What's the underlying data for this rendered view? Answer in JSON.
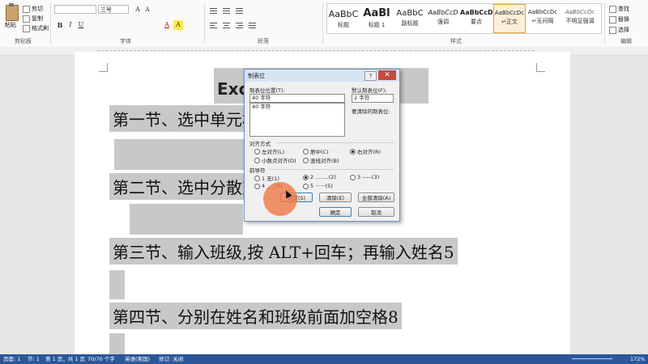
{
  "ribbon": {
    "paste_label": "粘贴",
    "cut_label": "剪切",
    "copy_label": "复制",
    "format_painter_label": "格式刷",
    "clipboard_label": "剪贴板",
    "font_size_value": "三号",
    "font_label": "字体",
    "paragraph_label": "段落",
    "styles_label": "样式",
    "editing_label": "编辑",
    "bold": "B",
    "italic": "I",
    "underline": "U",
    "font_a": "A",
    "find_label": "查找",
    "replace_label": "替换",
    "select_label": "选择",
    "styles": [
      {
        "sample": "AaBbC",
        "name": "标题"
      },
      {
        "sample": "AaBl",
        "name": "标题 1"
      },
      {
        "sample": "AaBbC",
        "name": "副标题"
      },
      {
        "sample": "AaBbCcD",
        "name": "强调"
      },
      {
        "sample": "AaBbCcD",
        "name": "要点"
      },
      {
        "sample": "AaBbCcDc",
        "name": "↵正文"
      },
      {
        "sample": "AaBbCcDc",
        "name": "↵无间隔"
      },
      {
        "sample": "AaBbCcDc",
        "name": "不明显强调"
      }
    ]
  },
  "document": {
    "title": "Exc方法",
    "lines": [
      "第一节、选中单元格",
      "第二节、选中分散对",
      "第三节、输入班级,按 ALT+回车；再输入姓名5",
      "第四节、分别在姓名和班级前面加空格8"
    ]
  },
  "dialog": {
    "title": "制表位",
    "help": "?",
    "close": "✕",
    "tab_position_label": "制表位位置(T):",
    "tab_position_value": "40 字符",
    "tab_list": [
      "40 字符"
    ],
    "default_tab_label": "默认制表位(F):",
    "default_tab_value": "2 字符",
    "to_clear_label": "要清除的制表位:",
    "alignment_label": "对齐方式",
    "align_left": "左对齐(L)",
    "align_center": "居中(C)",
    "align_right": "右对齐(R)",
    "align_decimal": "小数点对齐(D)",
    "align_bar": "竖线对齐(B)",
    "leader_label": "前导符",
    "leader_1": "1 无(1)",
    "leader_2": "2 ........(2)",
    "leader_3": "3 -----(3)",
    "leader_4": "4 ___(4)",
    "leader_5": "5 ······(5)",
    "set_button": "设置(S)",
    "clear_button": "清除(E)",
    "clear_all_button": "全部清除(A)",
    "ok_button": "确定",
    "cancel_button": "取消"
  },
  "status": {
    "page": "页面: 1",
    "section": "节: 1",
    "page_of": "第 1 页，共 1 页",
    "words": "70/70 个字",
    "language": "英语(美国)",
    "track": "修订: 关闭",
    "zoom": "172%"
  },
  "colors": {
    "selection": "#c8c8c8",
    "statusbar": "#2b579a",
    "cursor_highlight": "#f0784b"
  }
}
